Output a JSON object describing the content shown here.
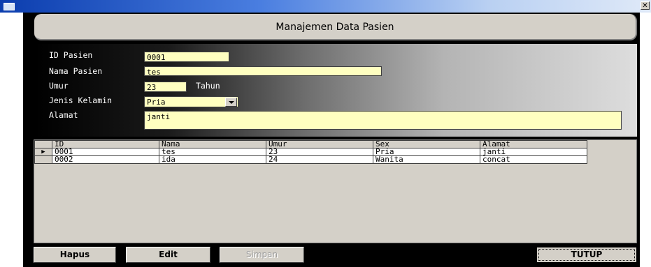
{
  "window": {
    "close_glyph": "✕"
  },
  "header": {
    "title": "Manajemen Data Pasien"
  },
  "form": {
    "id_label": "ID Pasien",
    "id_value": "0001",
    "nama_label": "Nama Pasien",
    "nama_value": "tes",
    "umur_label": "Umur",
    "umur_value": "23",
    "umur_unit": "Tahun",
    "jk_label": "Jenis Kelamin",
    "jk_value": "Pria",
    "alamat_label": "Alamat",
    "alamat_value": "janti"
  },
  "grid": {
    "current_row_marker": "▶",
    "columns": [
      "ID",
      "Nama",
      "Umur",
      "Sex",
      "Alamat"
    ],
    "rows": [
      [
        "0001",
        "tes",
        "23",
        "Pria",
        "janti"
      ],
      [
        "0002",
        "ida",
        "24",
        "Wanita",
        "concat"
      ]
    ]
  },
  "buttons": {
    "hapus": "Hapus",
    "edit": "Edit",
    "simpan": "Simpan",
    "tutup": "TUTUP"
  },
  "colors": {
    "title_bar": "#0b3dae",
    "field_bg": "#ffffc0",
    "panel": "#d4d0c8"
  }
}
